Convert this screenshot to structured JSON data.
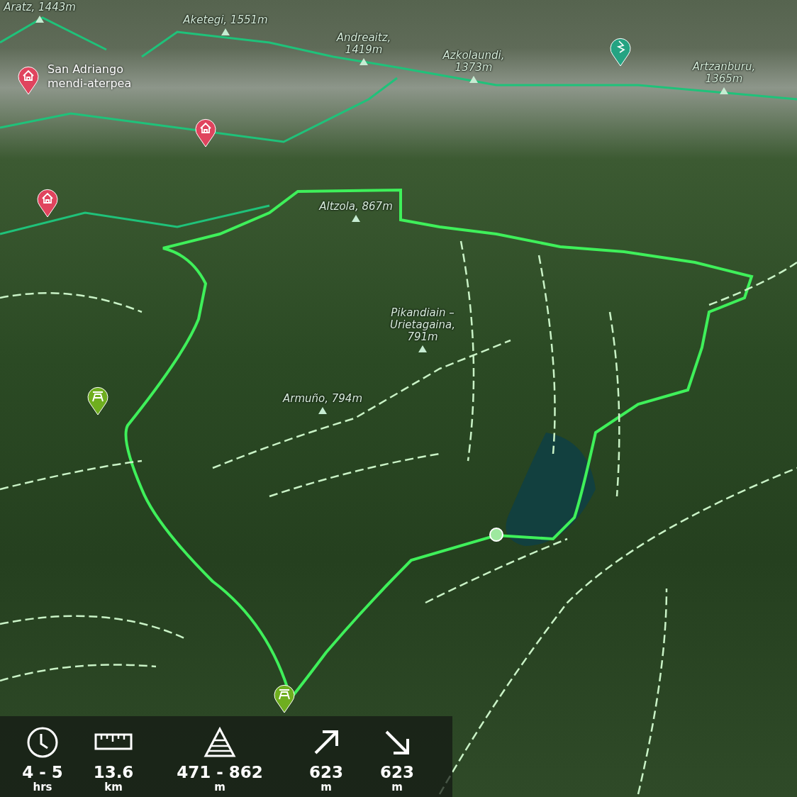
{
  "map": {
    "peaks": [
      {
        "name": "Aratz, 1443m"
      },
      {
        "name": "Aketegi, 1551m"
      },
      {
        "name": "Andreaitz,\n1419m"
      },
      {
        "name": "Azkolaundi,\n1373m"
      },
      {
        "name": "Artzanburu,\n1365m"
      },
      {
        "name": "Altzola, 867m"
      },
      {
        "name": "Pikandiain –\nUrietagaina,\n791m"
      },
      {
        "name": "Armuño, 794m"
      }
    ],
    "markers": [
      {
        "kind": "shelter",
        "label": "San Adriango\nmendi-aterpea"
      },
      {
        "kind": "shelter"
      },
      {
        "kind": "shelter"
      },
      {
        "kind": "picnic"
      },
      {
        "kind": "picnic"
      },
      {
        "kind": "climbing"
      }
    ]
  },
  "stats": [
    {
      "kind": "duration",
      "value": "4 - 5",
      "unit": "hrs"
    },
    {
      "kind": "distance",
      "value": "13.6",
      "unit": "km"
    },
    {
      "kind": "altitude",
      "value": "471 - 862",
      "unit": "m"
    },
    {
      "kind": "ascent",
      "value": "623",
      "unit": "m"
    },
    {
      "kind": "descent",
      "value": "623",
      "unit": "m"
    }
  ]
}
